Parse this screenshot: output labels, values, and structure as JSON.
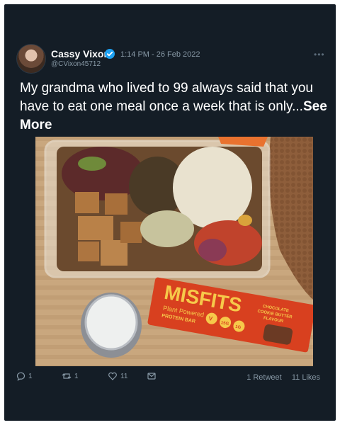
{
  "tweet": {
    "author_name": "Cassy Vixon",
    "handle": "@CVixon45712",
    "time": "1:14 PM",
    "separator": " - ",
    "date": "26 Feb 2022",
    "menu": "•••",
    "text": "My grandma who lived to 99 always said that you have to eat one meal once a week that is only...",
    "see_more": "See More"
  },
  "photo": {
    "product_brand": "MISFITS",
    "product_line1": "Plant Powered",
    "product_line2": "PROTEIN BAR",
    "badge_v": "V",
    "badge_15g": "15G",
    "badge_1g": "1G",
    "flavor_line1": "CHOCOLATE",
    "flavor_line2": "COOKIE BUTTER",
    "flavor_line3": "FLAVOUR"
  },
  "actions": {
    "reply_count": "1",
    "retweet_count": "1",
    "like_count": "11",
    "retweets_label": "1 Retweet",
    "likes_label": "11 Likes"
  },
  "colors": {
    "background": "#141d26",
    "accent": "#1da1f2",
    "muted": "#8899a6"
  }
}
